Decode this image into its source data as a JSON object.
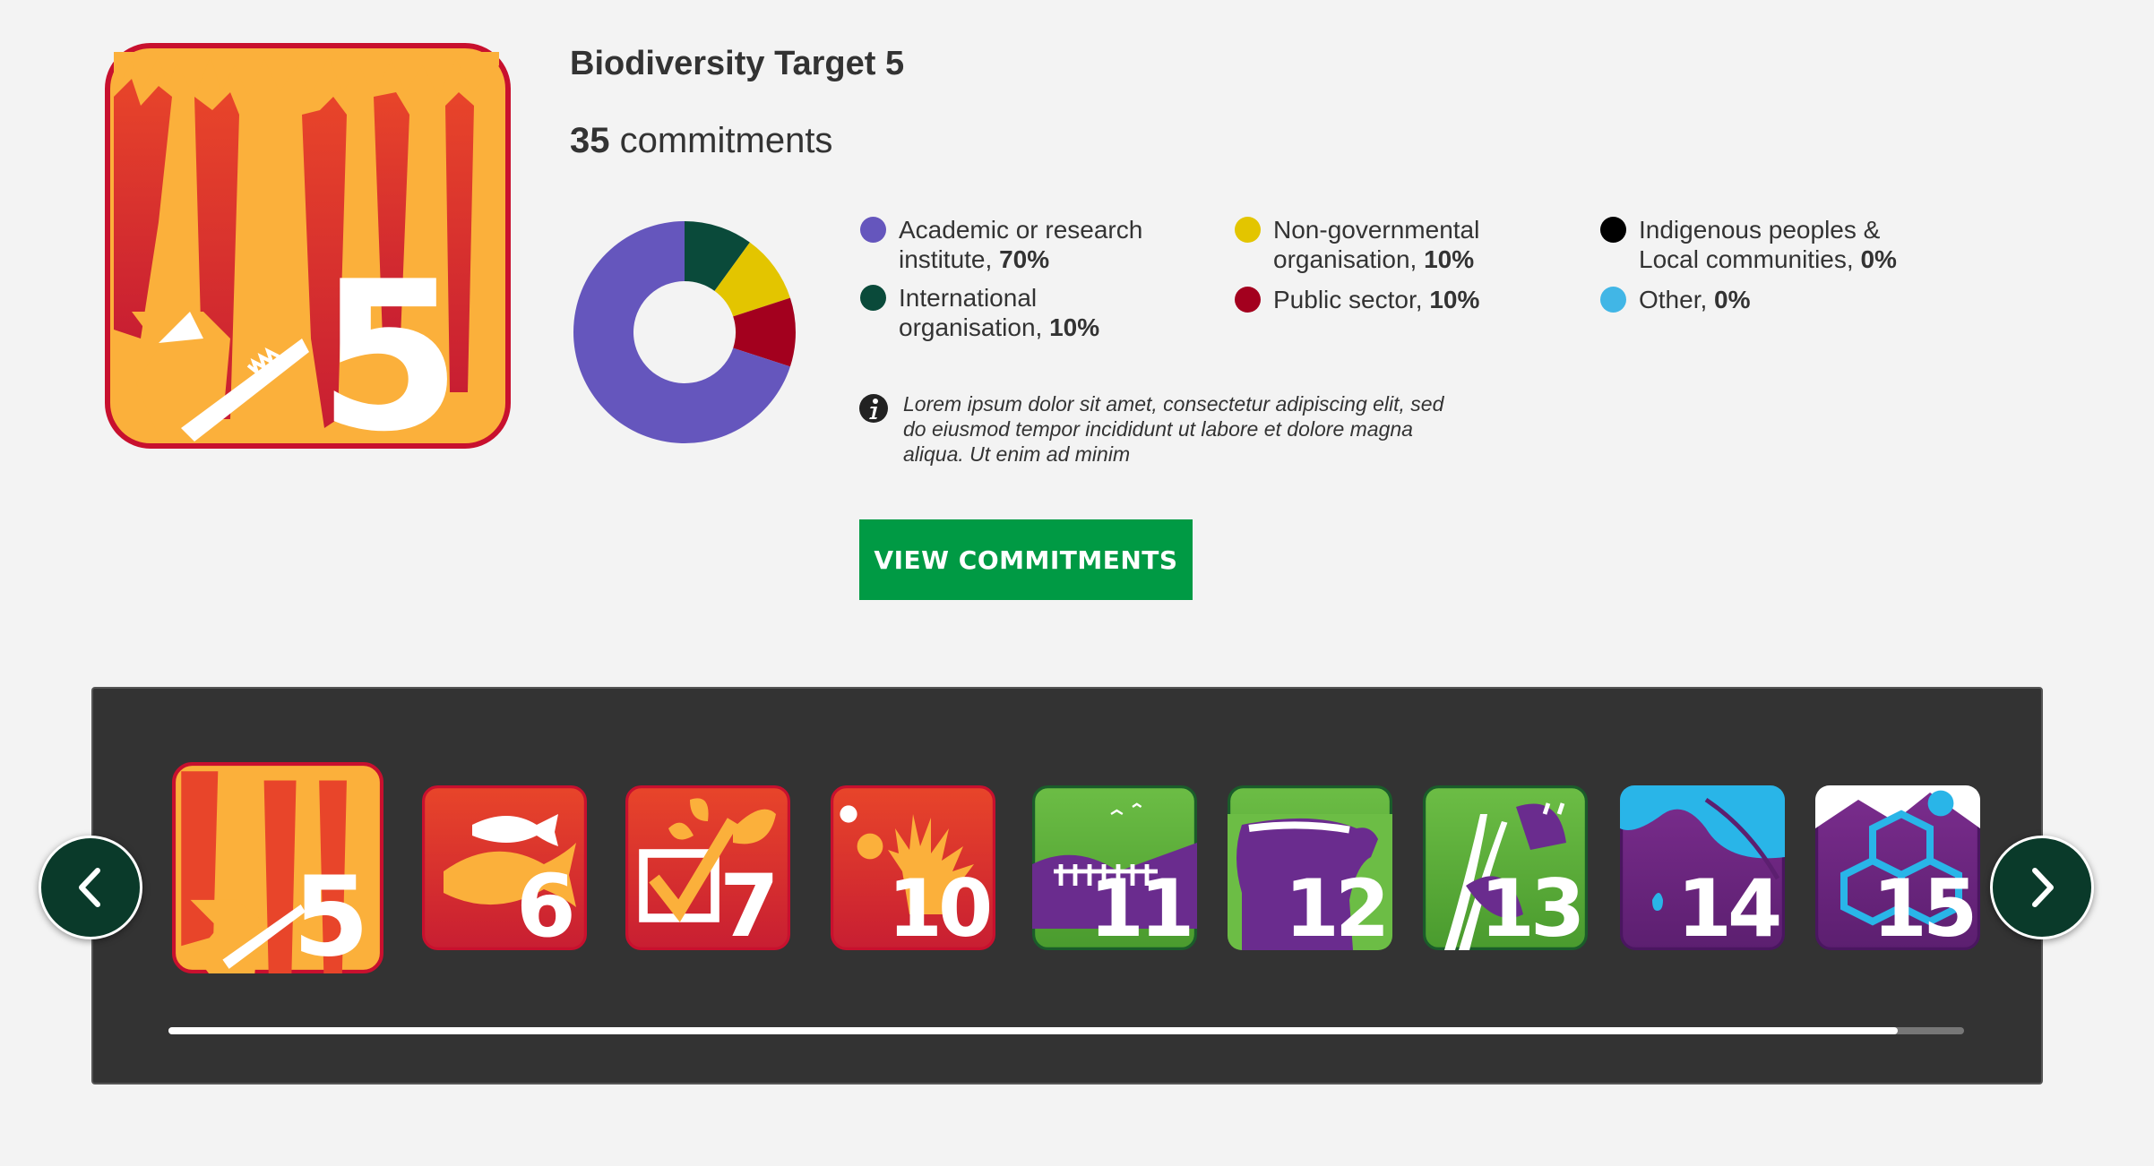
{
  "target": {
    "title": "Biodiversity Target 5",
    "count": "35",
    "count_label": " commitments",
    "number": "5"
  },
  "chart_data": {
    "type": "pie",
    "categories": [
      "Academic or research institute",
      "International organisation",
      "Non-governmental organisation",
      "Public sector",
      "Indigenous peoples & Local communities",
      "Other"
    ],
    "values": [
      70,
      10,
      10,
      10,
      0,
      0
    ],
    "colors": [
      "#6556bd",
      "#0a4a3a",
      "#e3c500",
      "#a3001e",
      "#000000",
      "#41b6e6"
    ]
  },
  "legend": [
    {
      "label": "Academic or research\ninstitute, ",
      "pct": "70%",
      "color": "#6556bd"
    },
    {
      "label": "International\norganisation, ",
      "pct": "10%",
      "color": "#0a4a3a"
    },
    {
      "label": "Non-governmental\norganisation, ",
      "pct": "10%",
      "color": "#e3c500"
    },
    {
      "label": "Public sector, ",
      "pct": "10%",
      "color": "#a3001e"
    },
    {
      "label": "Indigenous peoples &\nLocal communities, ",
      "pct": "0%",
      "color": "#000000"
    },
    {
      "label": "Other, ",
      "pct": "0%",
      "color": "#41b6e6"
    }
  ],
  "info_text": "Lorem ipsum dolor sit amet, consectetur adipiscing elit, sed do eiusmod tempor incididunt ut labore et dolore magna aliqua. Ut enim ad minim",
  "view_button": "VIEW COMMITMENTS",
  "carousel": {
    "targets": [
      {
        "number": "5",
        "theme": "orange",
        "icon": "deforestation-icon",
        "selected": true
      },
      {
        "number": "6",
        "theme": "orange",
        "icon": "fish-icon"
      },
      {
        "number": "7",
        "theme": "orange",
        "icon": "sustainable-agriculture-icon"
      },
      {
        "number": "10",
        "theme": "orange",
        "icon": "coral-reef-icon"
      },
      {
        "number": "11",
        "theme": "green",
        "icon": "protected-areas-icon"
      },
      {
        "number": "12",
        "theme": "green",
        "icon": "endangered-species-icon"
      },
      {
        "number": "13",
        "theme": "green",
        "icon": "genetic-diversity-icon"
      },
      {
        "number": "14",
        "theme": "purple",
        "icon": "ecosystem-services-icon"
      },
      {
        "number": "15",
        "theme": "purple",
        "icon": "ecosystem-resilience-icon"
      }
    ],
    "scroll_progress": 0.963
  },
  "nav": {
    "prev_icon": "chevron-left-icon",
    "next_icon": "chevron-right-icon"
  }
}
